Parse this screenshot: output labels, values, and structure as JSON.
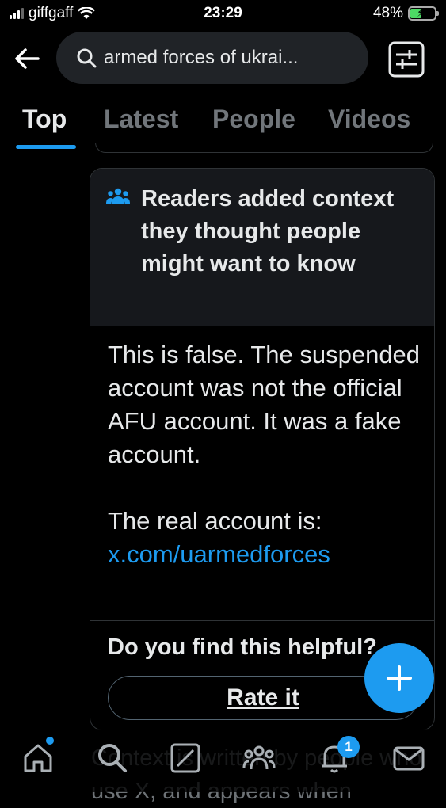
{
  "status_bar": {
    "carrier": "giffgaff",
    "time": "23:29",
    "battery": "48%",
    "battery_level": 0.48
  },
  "search": {
    "query": "armed forces of ukrai..."
  },
  "tabs": [
    {
      "label": "Top",
      "active": true
    },
    {
      "label": "Latest",
      "active": false
    },
    {
      "label": "People",
      "active": false
    },
    {
      "label": "Videos",
      "active": false
    }
  ],
  "note": {
    "title": "Readers added context they thought people might want to know",
    "body_line1": "This is false. The suspended account was not the official AFU account. It was a fake account.",
    "body_line2": "The real account is:",
    "link": "x.com/uarmedforces",
    "helpful_prompt": "Do you find this helpful?",
    "rate_button": "Rate it"
  },
  "below_text": "Context is written by people who use X, and appears when",
  "nav": {
    "notifications_badge": "1"
  },
  "colors": {
    "accent": "#1d9bf0",
    "background": "#000000",
    "card_header": "#16181c"
  }
}
